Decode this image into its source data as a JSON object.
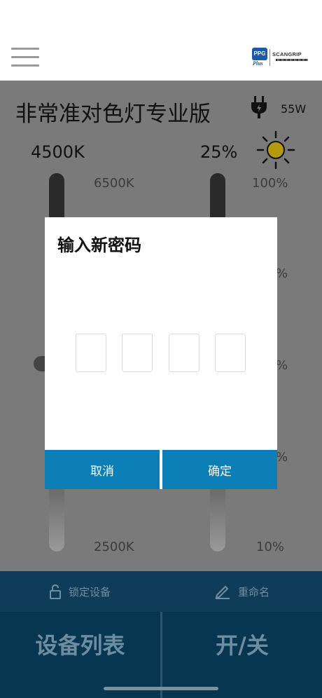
{
  "device": {
    "title": "非常准对色灯专业版",
    "power": "55W"
  },
  "color_temp": {
    "current": "4500K",
    "max_label": "6500K",
    "min_label": "2500K"
  },
  "brightness": {
    "current": "25%",
    "max_label": "100%",
    "min_label": "10%",
    "peek_labels": [
      "%",
      "%",
      "%"
    ]
  },
  "toolbar": {
    "lock_label": "锁定设备",
    "rename_label": "重命名"
  },
  "nav": {
    "devices_label": "设备列表",
    "power_label": "开/关"
  },
  "dialog": {
    "title": "输入新密码",
    "pin_digits": [
      "",
      "",
      "",
      ""
    ],
    "cancel_label": "取消",
    "confirm_label": "确定"
  },
  "colors": {
    "accent": "#0b7fb5",
    "nav_bg": "#063650",
    "toolbar_bg": "#0f3d59",
    "overlay": "#7a7a7a"
  },
  "icons": {
    "menu": "hamburger-menu-icon",
    "plug": "plug-icon",
    "sun": "sun-icon",
    "lock": "unlock-icon",
    "rename": "pencil-icon"
  }
}
